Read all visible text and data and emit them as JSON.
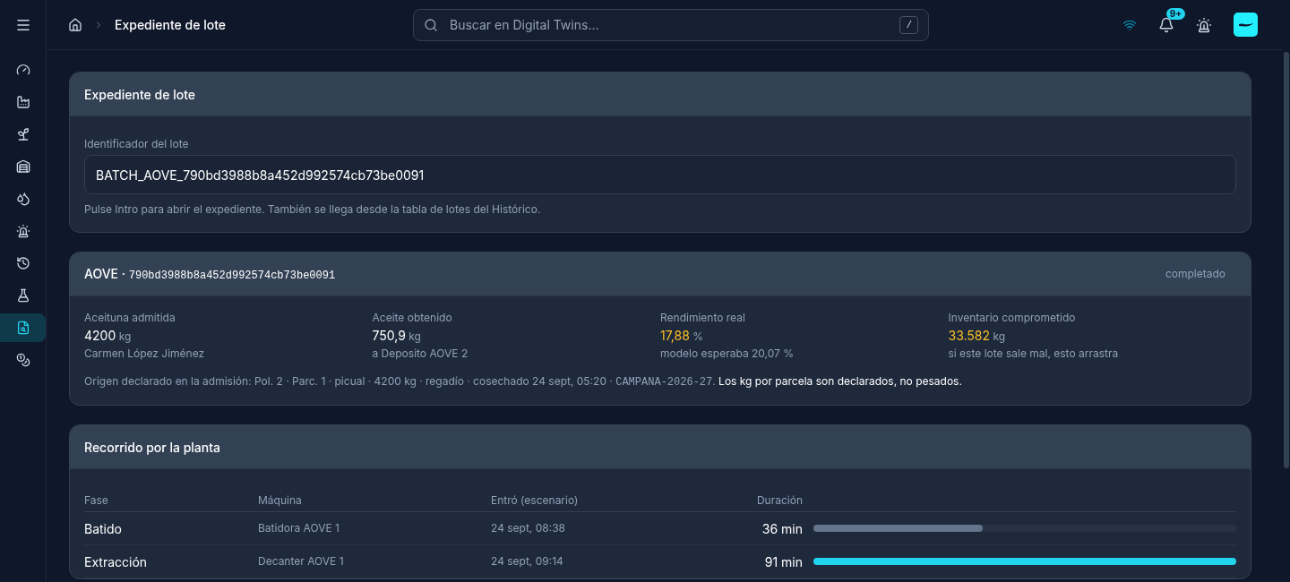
{
  "sidebar": {
    "items": [
      {
        "selected": false
      },
      {
        "selected": false
      },
      {
        "selected": false
      },
      {
        "selected": false
      },
      {
        "selected": false
      },
      {
        "selected": false
      },
      {
        "selected": false
      },
      {
        "selected": false
      },
      {
        "selected": true
      },
      {
        "selected": false
      }
    ]
  },
  "topbar": {
    "breadcrumb": "Expediente de lote",
    "search": {
      "placeholder": "Buscar en Digital Twins...",
      "shortcut": "/"
    },
    "notifications_badge": "9+"
  },
  "lookup_card": {
    "title": "Expediente de lote",
    "field_label": "Identificador del lote",
    "value": "BATCH_AOVE_790bd3988b8a452d992574cb73be0091",
    "hint": "Pulse Intro para abrir el expediente. También se llega desde la tabla de lotes del Histórico."
  },
  "batch_card": {
    "product": "AOVE ·",
    "batch_id": "790bd3988b8a452d992574cb73be0091",
    "status": "completado",
    "stats": [
      {
        "label": "Aceituna admitida",
        "value": "4200",
        "unit": "kg",
        "note": "Carmen López Jiménez",
        "highlighted": false
      },
      {
        "label": "Aceite obtenido",
        "value": "750,9",
        "unit": "kg",
        "note": "a Deposito AOVE 2",
        "highlighted": false
      },
      {
        "label": "Rendimiento real",
        "value": "17,88",
        "unit": "%",
        "note": "modelo esperaba 20,07 %",
        "highlighted": true
      },
      {
        "label": "Inventario comprometido",
        "value": "33.582",
        "unit": "kg",
        "note": "si este lote sale mal, esto arrastra",
        "highlighted": true
      }
    ],
    "origin": {
      "text": "Origen declarado en la admisión: Pol. 2 · Parc. 1 · picual · 4200 kg · regadío · cosechado 24 sept, 05:20 · ",
      "code": "CAMPANA-2026-27",
      "after": ".",
      "emphasis": "Los kg por parcela son declarados, no pesados."
    }
  },
  "route_card": {
    "title": "Recorrido por la planta",
    "columns": [
      "Fase",
      "Máquina",
      "Entró (escenario)",
      "Duración"
    ],
    "rows": [
      {
        "phase": "Batido",
        "machine": "Batidora AOVE 1",
        "entered": "24 sept, 08:38",
        "duration": "36 min",
        "level": 0.4,
        "color": "#64748b"
      },
      {
        "phase": "Extracción",
        "machine": "Decanter AOVE 1",
        "entered": "24 sept, 09:14",
        "duration": "91 min",
        "level": 1,
        "color": "#22d3ee"
      }
    ]
  }
}
